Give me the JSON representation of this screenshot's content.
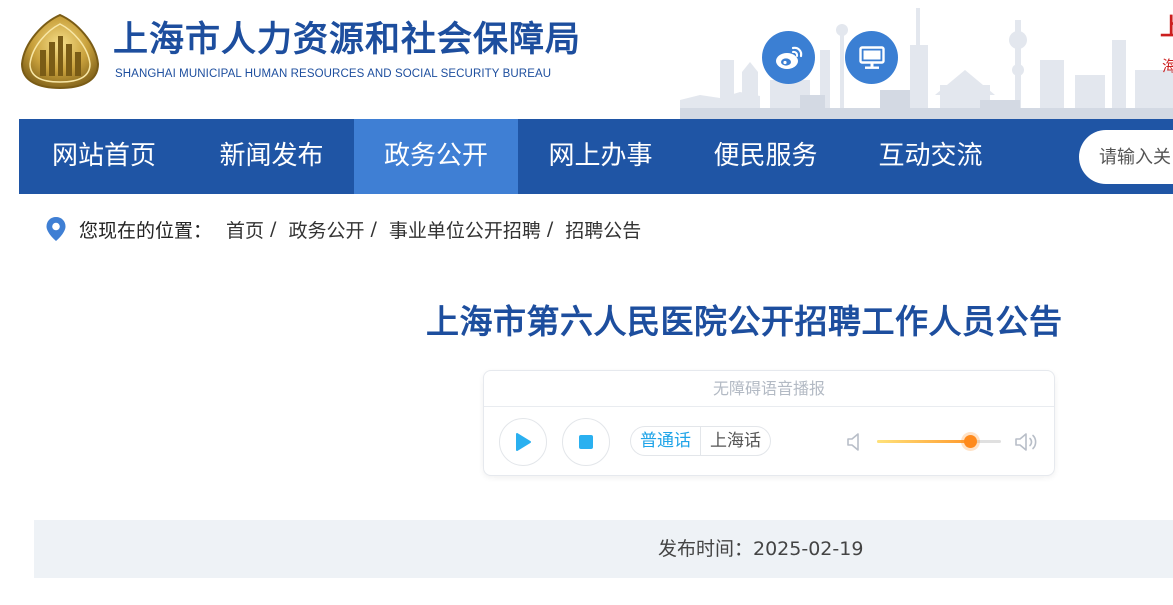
{
  "header": {
    "title": "上海市人力资源和社会保障局",
    "subtitle": "SHANGHAI MUNICIPAL HUMAN RESOURCES AND SOCIAL SECURITY BUREAU",
    "edge_red_top": "上",
    "edge_red_bottom": "海",
    "buttons": [
      {
        "icon": "weibo-icon"
      },
      {
        "icon": "desktop-monitor-icon"
      }
    ]
  },
  "nav": {
    "items": [
      {
        "label": "网站首页"
      },
      {
        "label": "新闻发布"
      },
      {
        "label": "政务公开"
      },
      {
        "label": "网上办事"
      },
      {
        "label": "便民服务"
      },
      {
        "label": "互动交流"
      }
    ],
    "active_item": "政务公开",
    "search": {
      "placeholder": "请输入关"
    }
  },
  "breadcrumb": {
    "label": "您现在的位置：",
    "items": [
      "首页",
      "政务公开",
      "事业单位公开招聘",
      "招聘公告"
    ],
    "separator": "/"
  },
  "article": {
    "title": "上海市第六人民医院公开招聘工作人员公告"
  },
  "player": {
    "header": "无障碍语音播报",
    "languages": [
      "普通话",
      "上海话"
    ],
    "selected_language": "普通话",
    "volume": 0.75,
    "colors": {
      "accent": "#1fa4e8",
      "volume": "#ff8a1c"
    }
  },
  "publish": {
    "text": "发布时间：2025-02-19"
  },
  "colors": {
    "nav_bg": "#1f55a5",
    "nav_active": "#3f7fd4",
    "title_blue": "#1d4e9e",
    "icon_circle": "#3b7fd3"
  }
}
